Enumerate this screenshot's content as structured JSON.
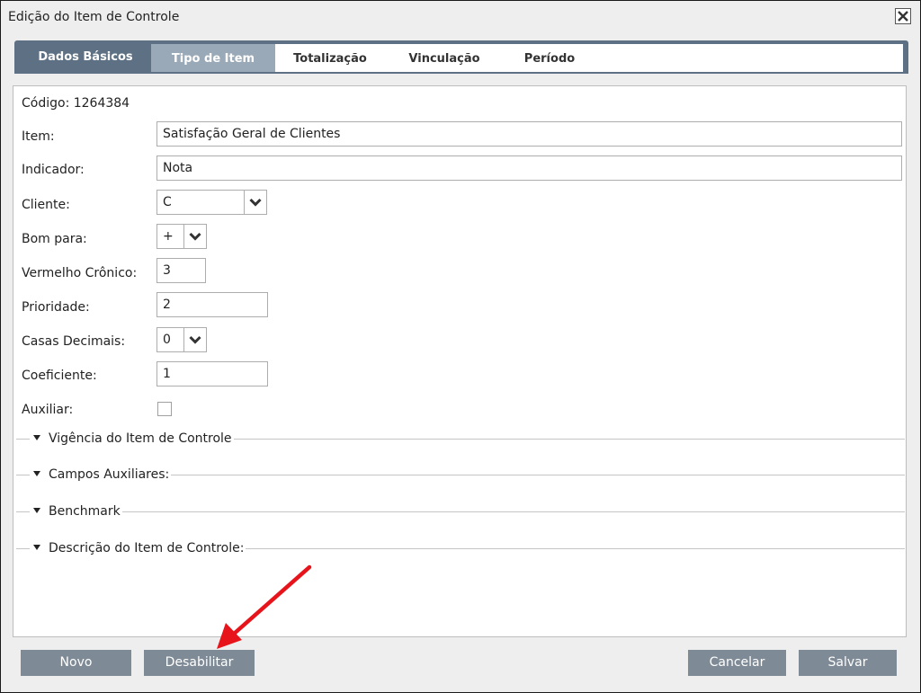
{
  "window": {
    "title": "Edição do Item de Controle"
  },
  "tabs": [
    {
      "label": "Dados Básicos"
    },
    {
      "label": "Tipo de Item"
    },
    {
      "label": "Totalização"
    },
    {
      "label": "Vinculação"
    },
    {
      "label": "Período"
    }
  ],
  "form": {
    "codigo_text": "Código: 1264384",
    "item": {
      "label": "Item:",
      "value": "Satisfação Geral de Clientes"
    },
    "indicador": {
      "label": "Indicador:",
      "value": "Nota"
    },
    "cliente": {
      "label": "Cliente:",
      "value": "C"
    },
    "bom_para": {
      "label": "Bom para:",
      "value": "+"
    },
    "vermelho_cronico": {
      "label": "Vermelho Crônico:",
      "value": "3"
    },
    "prioridade": {
      "label": "Prioridade:",
      "value": "2"
    },
    "casas_decimais": {
      "label": "Casas Decimais:",
      "value": "0"
    },
    "coeficiente": {
      "label": "Coeficiente:",
      "value": "1"
    },
    "auxiliar": {
      "label": "Auxiliar:",
      "checked": false
    }
  },
  "sections": [
    {
      "label": "Vigência do Item de Controle"
    },
    {
      "label": "Campos Auxiliares:"
    },
    {
      "label": "Benchmark"
    },
    {
      "label": "Descrição do Item de Controle:"
    }
  ],
  "buttons": {
    "novo": "Novo",
    "desabilitar": "Desabilitar",
    "cancelar": "Cancelar",
    "salvar": "Salvar"
  },
  "colors": {
    "tab_active": "#5e7083",
    "tab_secondary": "#9aa9b7",
    "button": "#7e8a96",
    "annotation_arrow": "#e8141b"
  },
  "icons": {
    "close": "close-icon",
    "dropdown": "chevron-down-icon",
    "section_toggle": "caret-down-icon",
    "annotation": "red-arrow-annotation"
  }
}
